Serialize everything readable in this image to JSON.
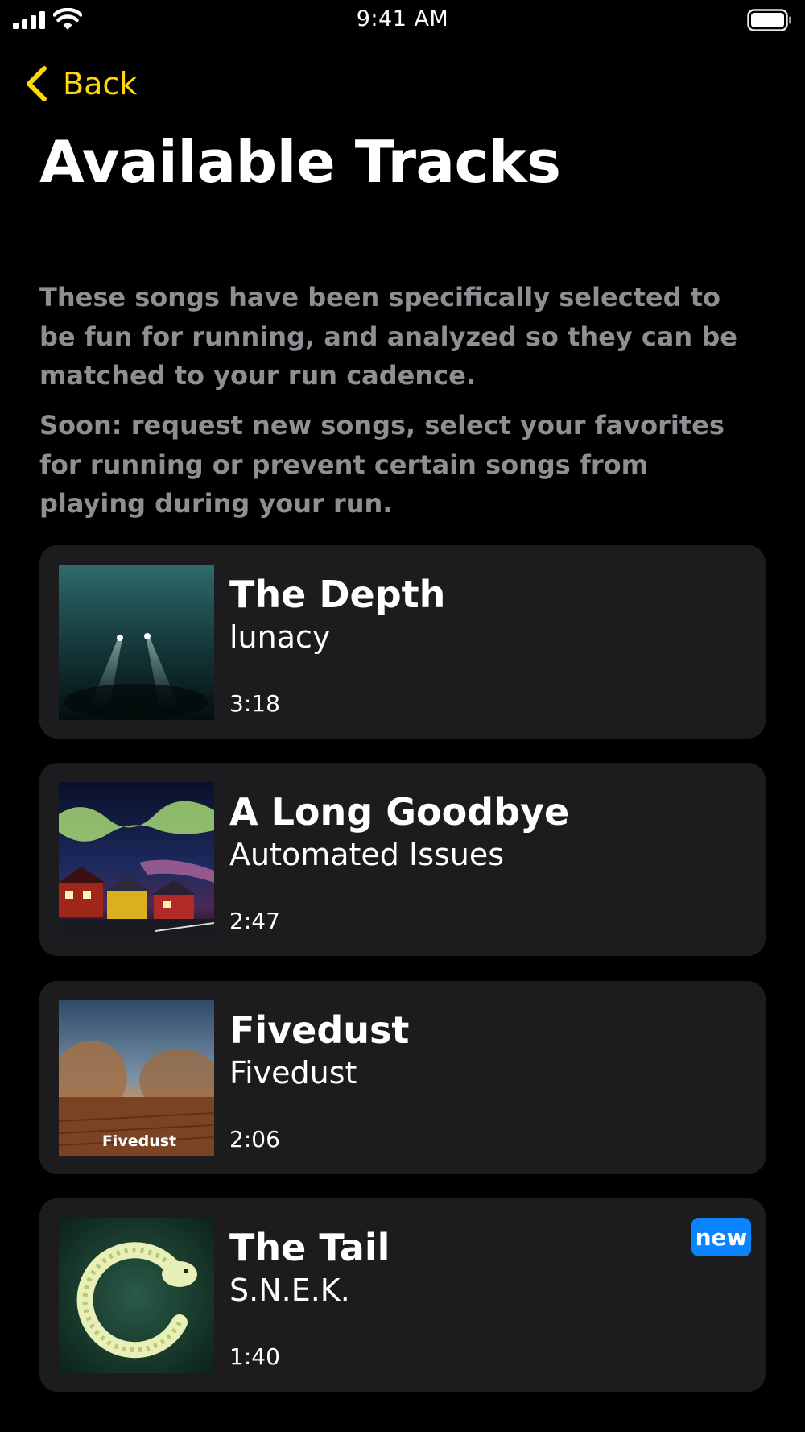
{
  "status_bar": {
    "time": "9:41 AM"
  },
  "nav": {
    "back_label": "Back"
  },
  "page": {
    "title": "Available Tracks",
    "description": [
      "These songs have been specifically selected to be fun for running, and analyzed so they can be matched to your run cadence.",
      "Soon: request new songs, select your favorites for running or prevent certain songs from playing during your run."
    ]
  },
  "colors": {
    "accent": "#ffd60a",
    "badge": "#0a84ff",
    "card_bg": "#1c1c1e",
    "secondary_text": "#8e8e93"
  },
  "tracks": [
    {
      "title": "The Depth",
      "artist": "lunacy",
      "duration": "3:18",
      "art_icon": "underwater-divers-artwork"
    },
    {
      "title": "A Long Goodbye",
      "artist": "Automated Issues",
      "duration": "2:47",
      "art_icon": "aurora-houses-artwork"
    },
    {
      "title": "Fivedust",
      "artist": "Fivedust",
      "duration": "2:06",
      "art_icon": "dust-storm-artwork",
      "art_text": "Fivedust"
    },
    {
      "title": "The Tail",
      "artist": "S.N.E.K.",
      "duration": "1:40",
      "badge": "new",
      "art_icon": "snake-circle-artwork"
    }
  ]
}
